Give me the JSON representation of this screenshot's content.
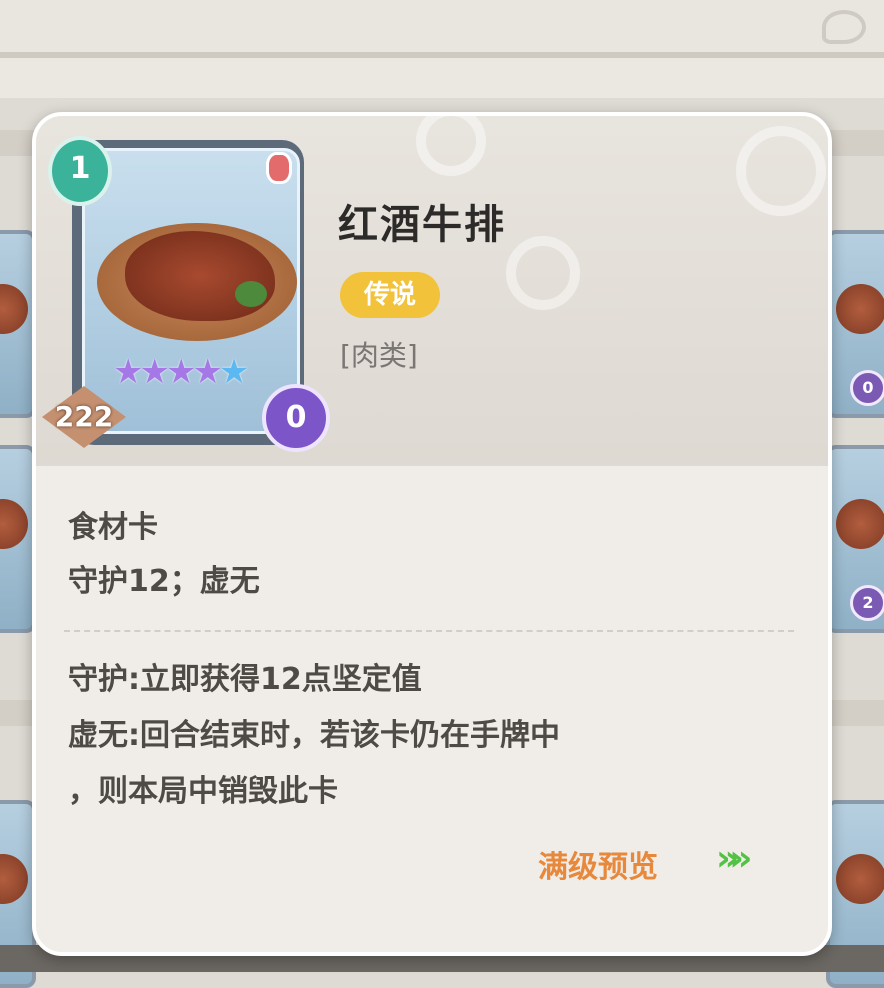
{
  "card": {
    "name": "红酒牛排",
    "rarity": "传说",
    "category": "[肉类]",
    "level": "1",
    "power": "222",
    "cost": "0",
    "stars_purple": "★★★★",
    "stars_blue": "★",
    "type": "食材卡",
    "keywords": "守护12；虚无",
    "description_lines": [
      "守护:立即获得12点坚定值",
      "虚无:回合结束时，若该卡仍在手牌中",
      "，则本局中销毁此卡"
    ],
    "preview_label": "满级预览",
    "preview_arrow": "»",
    "icons": {
      "level": "droplet-level-badge-icon",
      "category": "meat-icon",
      "cost": "stopwatch-cost-icon",
      "power": "diamond-power-icon",
      "arrow": "double-chevron-right-icon"
    }
  },
  "background_cards": {
    "costs": [
      "0",
      "2"
    ]
  },
  "colors": {
    "rarity_badge": "#f2c23a",
    "preview_link": "#e8883a",
    "arrow": "#52c244",
    "level_badge": "#3bb39a",
    "cost_badge": "#7c56c9"
  }
}
